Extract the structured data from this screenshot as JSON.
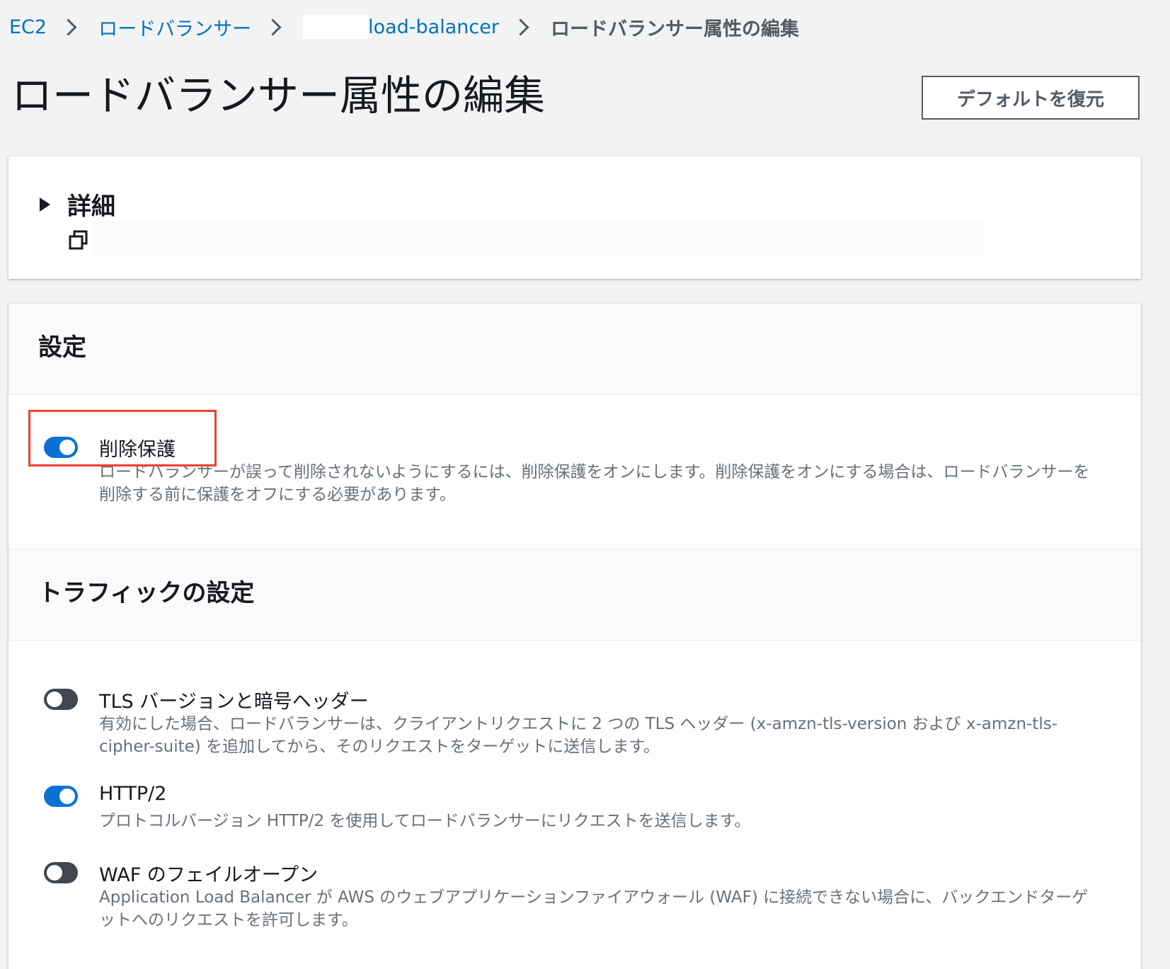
{
  "breadcrumb": {
    "items": [
      {
        "label": "EC2"
      },
      {
        "label": "ロードバランサー"
      },
      {
        "label": "load-balancer"
      },
      {
        "label": "ロードバランサー属性の編集"
      }
    ]
  },
  "header": {
    "title": "ロードバランサー属性の編集",
    "restore_button": "デフォルトを復元"
  },
  "details": {
    "title": "詳細",
    "copy_icon": "copy-icon"
  },
  "settings": {
    "title": "設定",
    "deletion_protection": {
      "label": "削除保護",
      "enabled": true,
      "description": "ロードバランサーが誤って削除されないようにするには、削除保護をオンにします。削除保護をオンにする場合は、ロードバランサーを削除する前に保護をオフにする必要があります。"
    }
  },
  "traffic": {
    "title": "トラフィックの設定",
    "options": [
      {
        "label": "TLS バージョンと暗号ヘッダー",
        "enabled": false,
        "description": "有効にした場合、ロードバランサーは、クライアントリクエストに 2 つの TLS ヘッダー (x-amzn-tls-version および x-amzn-tls-cipher-suite) を追加してから、そのリクエストをターゲットに送信します。"
      },
      {
        "label": "HTTP/2",
        "enabled": true,
        "description": "プロトコルバージョン HTTP/2 を使用してロードバランサーにリクエストを送信します。"
      },
      {
        "label": "WAF のフェイルオープン",
        "enabled": false,
        "description": "Application Load Balancer が AWS のウェブアプリケーションファイアウォール (WAF) に接続できない場合に、バックエンドターゲットへのリクエストを許可します。"
      }
    ]
  },
  "colors": {
    "link": "#0073bb",
    "toggle_on": "#0972d3",
    "toggle_off": "#414750",
    "highlight": "#e8432c"
  }
}
